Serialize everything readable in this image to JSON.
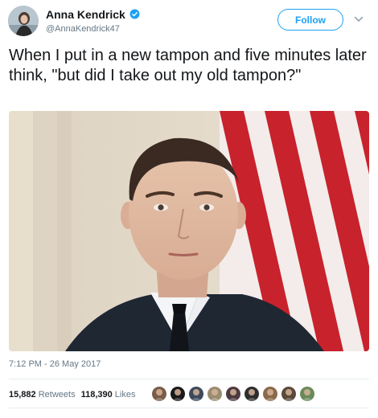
{
  "author": {
    "display_name": "Anna Kendrick",
    "handle": "@AnnaKendrick47",
    "verified": true
  },
  "follow_button": {
    "label": "Follow"
  },
  "tweet": {
    "text": "When I put in a new tampon and five minutes later think, \"but did I take out my old tampon?\"",
    "timestamp": "7:12 PM - 26 May 2017"
  },
  "stats": {
    "retweets_count": "15,882",
    "retweets_label": "Retweets",
    "likes_count": "118,390",
    "likes_label": "Likes"
  },
  "colors": {
    "accent": "#1da1f2",
    "secondary_text": "#657786",
    "primary_text": "#14171a",
    "divider": "#e6ecf0"
  },
  "icons": {
    "verified": "verified-badge-icon",
    "menu": "chevron-down-icon"
  },
  "likers": [
    {
      "name": "liker-avatar-1",
      "color": "#7a5c48"
    },
    {
      "name": "liker-avatar-2",
      "color": "#1a1a1a"
    },
    {
      "name": "liker-avatar-3",
      "color": "#3d4a5c"
    },
    {
      "name": "liker-avatar-4",
      "color": "#9a8c70"
    },
    {
      "name": "liker-avatar-5",
      "color": "#4d3a40"
    },
    {
      "name": "liker-avatar-6",
      "color": "#2e2e2e"
    },
    {
      "name": "liker-avatar-7",
      "color": "#8a6a4a"
    },
    {
      "name": "liker-avatar-8",
      "color": "#5a4a3a"
    },
    {
      "name": "liker-avatar-9",
      "color": "#6a8a5a"
    }
  ]
}
